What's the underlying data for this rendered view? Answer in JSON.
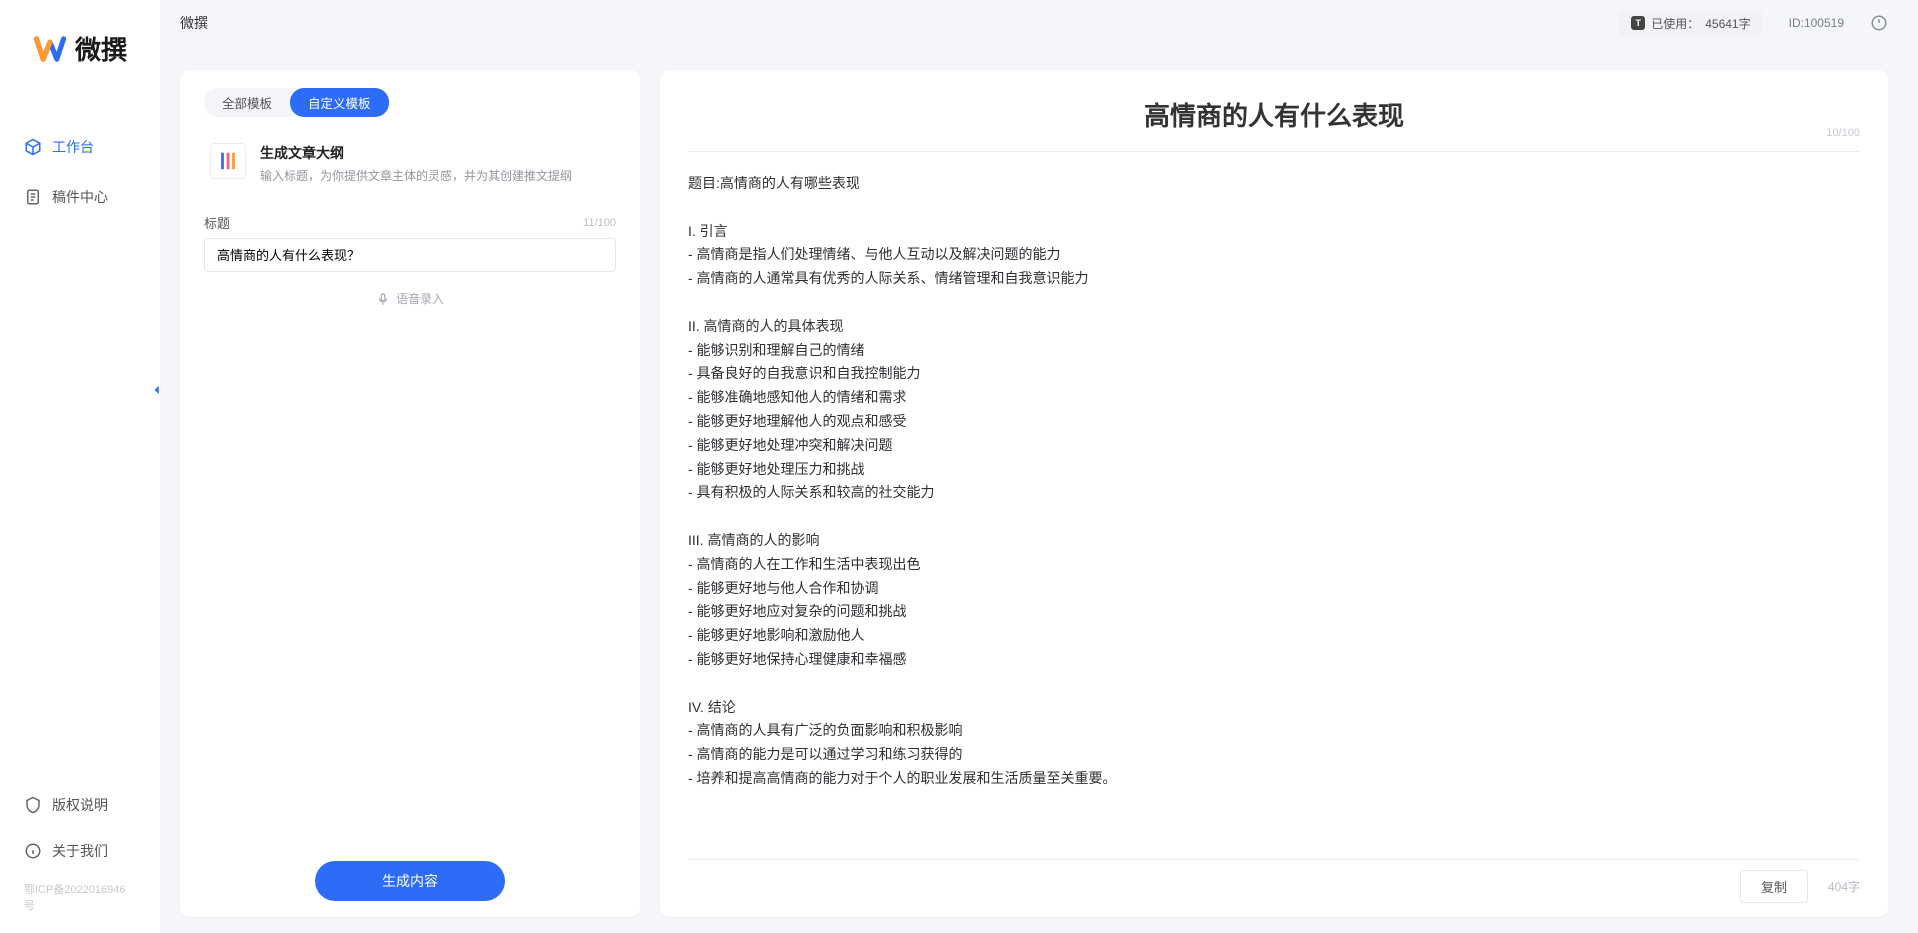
{
  "brand": {
    "name": "微撰"
  },
  "sidebar": {
    "items": [
      {
        "label": "工作台"
      },
      {
        "label": "稿件中心"
      }
    ],
    "bottom": [
      {
        "label": "版权说明"
      },
      {
        "label": "关于我们"
      }
    ],
    "icp": "鄂ICP备2022016946号"
  },
  "topbar": {
    "title": "微撰",
    "usage_prefix": "已使用：",
    "usage_value": "45641字",
    "user_id_label": "ID:100519"
  },
  "left": {
    "tabs": [
      {
        "label": "全部模板"
      },
      {
        "label": "自定义模板"
      }
    ],
    "template": {
      "name": "生成文章大纲",
      "desc": "输入标题，为你提供文章主体的灵感，并为其创建推文提纲"
    },
    "field_label": "标题",
    "counter": "11/100",
    "input_value": "高情商的人有什么表现？",
    "voice_label": "语音录入",
    "generate_btn": "生成内容"
  },
  "right": {
    "title": "高情商的人有什么表现",
    "title_counter": "10/100",
    "body": "题目:高情商的人有哪些表现\n\nI. 引言\n- 高情商是指人们处理情绪、与他人互动以及解决问题的能力\n- 高情商的人通常具有优秀的人际关系、情绪管理和自我意识能力\n\nII. 高情商的人的具体表现\n- 能够识别和理解自己的情绪\n- 具备良好的自我意识和自我控制能力\n- 能够准确地感知他人的情绪和需求\n- 能够更好地理解他人的观点和感受\n- 能够更好地处理冲突和解决问题\n- 能够更好地处理压力和挑战\n- 具有积极的人际关系和较高的社交能力\n\nIII. 高情商的人的影响\n- 高情商的人在工作和生活中表现出色\n- 能够更好地与他人合作和协调\n- 能够更好地应对复杂的问题和挑战\n- 能够更好地影响和激励他人\n- 能够更好地保持心理健康和幸福感\n\nIV. 结论\n- 高情商的人具有广泛的负面影响和积极影响\n- 高情商的能力是可以通过学习和练习获得的\n- 培养和提高高情商的能力对于个人的职业发展和生活质量至关重要。",
    "copy_btn": "复制",
    "word_count": "404字"
  }
}
